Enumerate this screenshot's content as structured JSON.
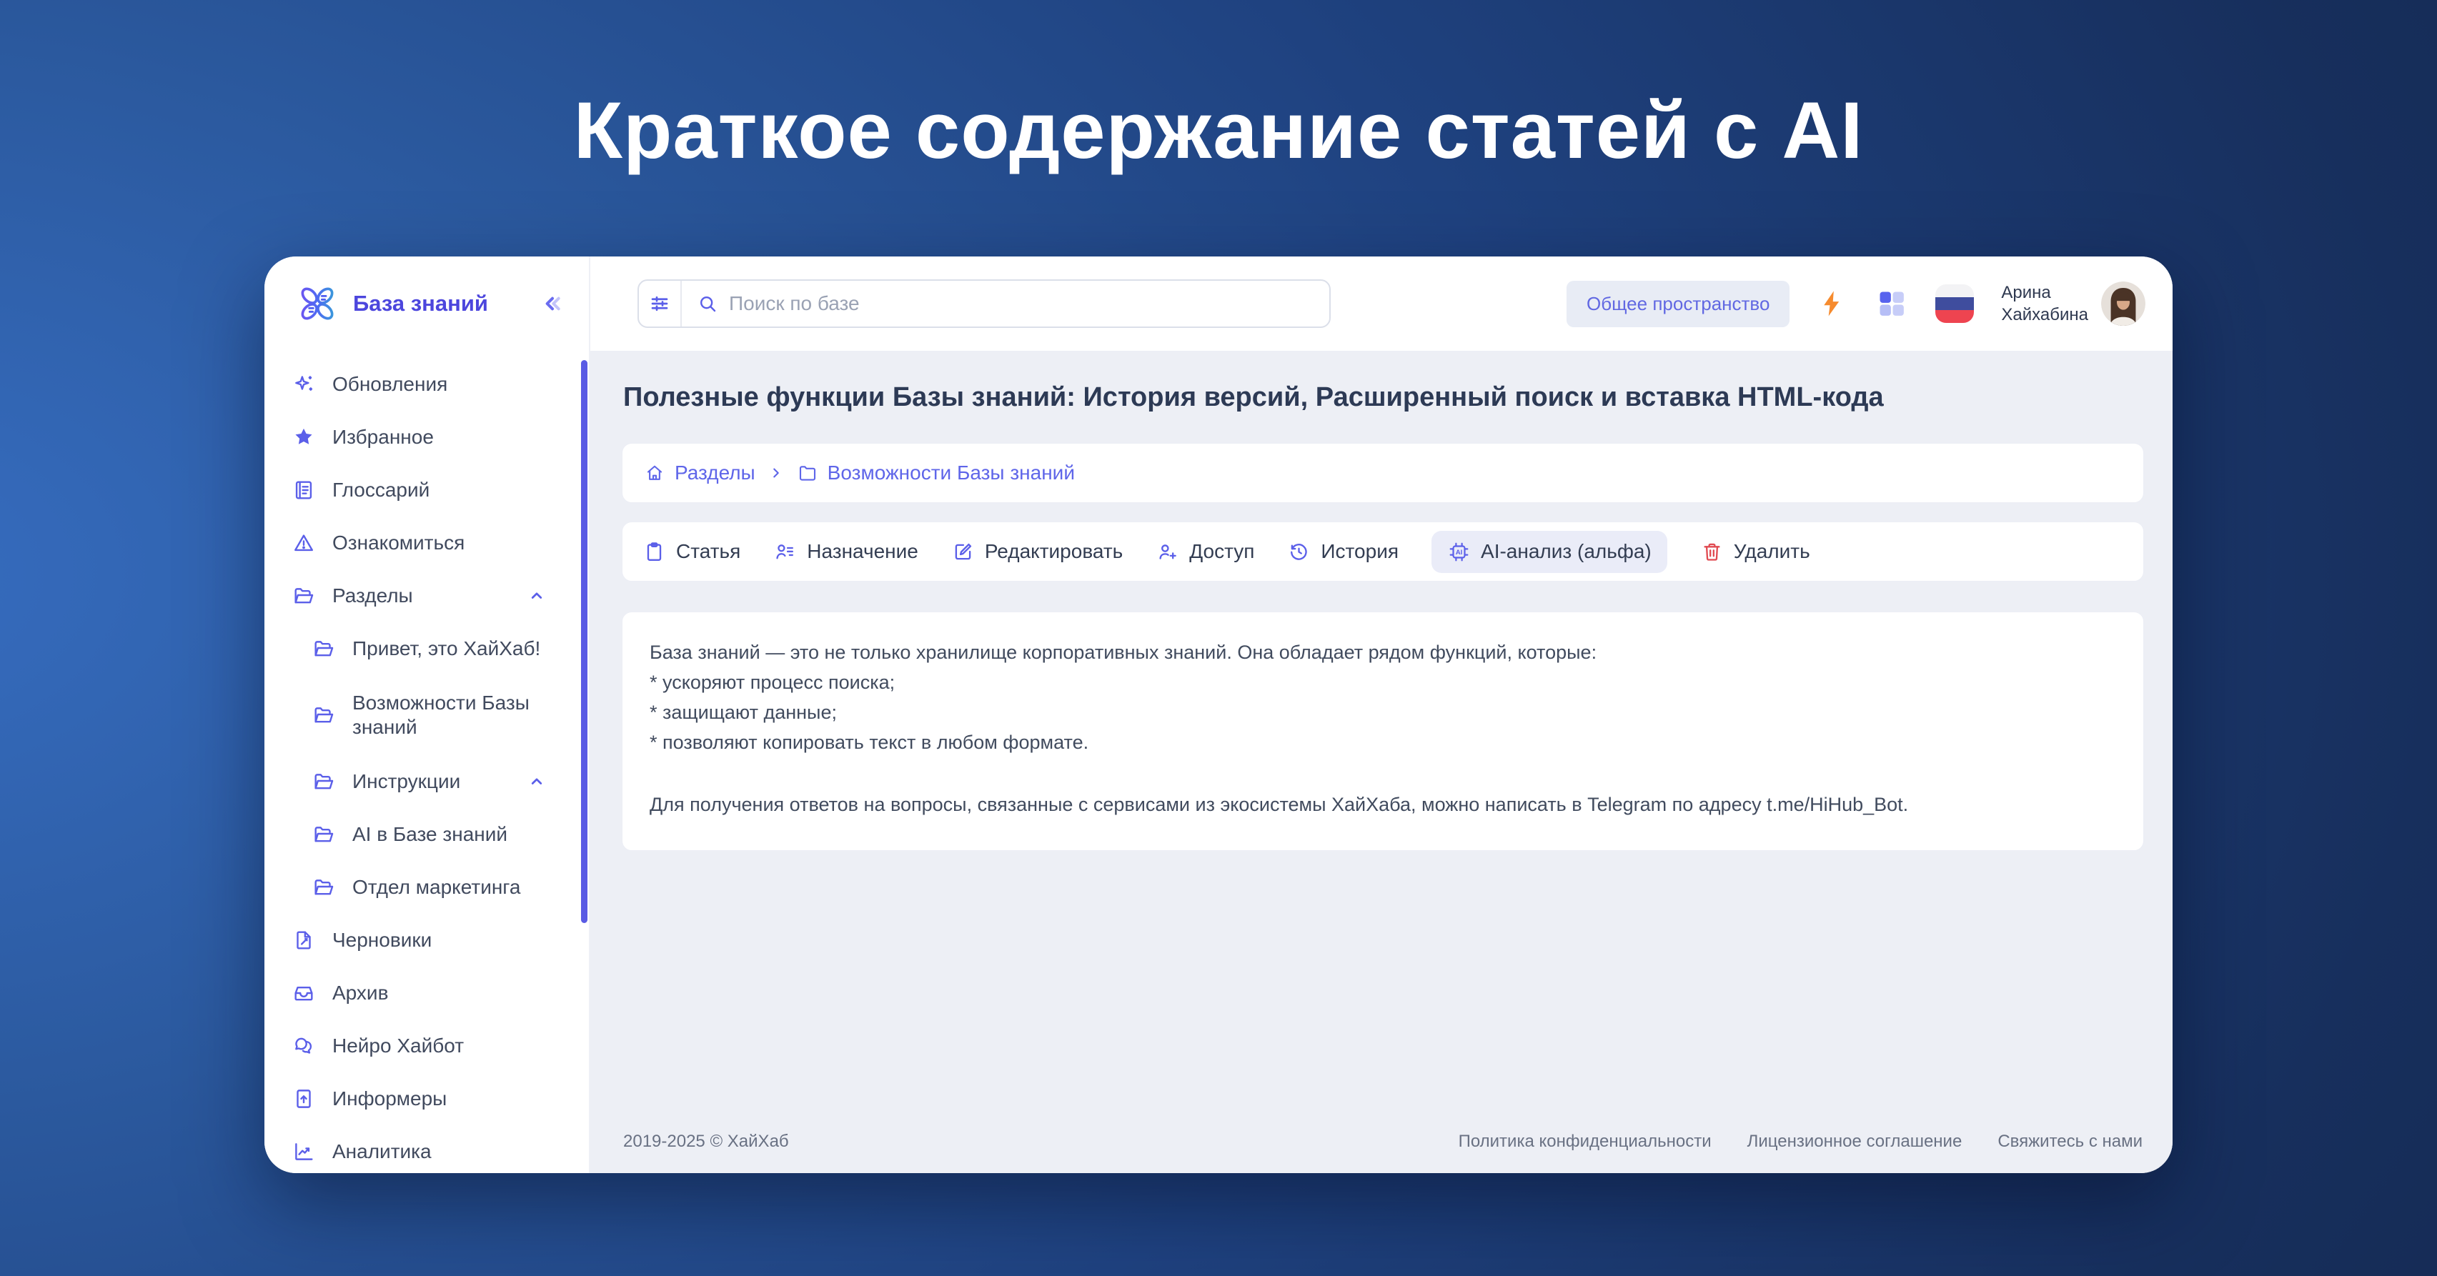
{
  "hero": {
    "title": "Краткое содержание статей с AI"
  },
  "app": {
    "name": "База знаний",
    "collapse_icon": "double-chevron-left-icon"
  },
  "sidebar": {
    "items": [
      {
        "label": "Обновления",
        "icon": "sparkles-icon",
        "level": 0
      },
      {
        "label": "Избранное",
        "icon": "star-icon",
        "level": 0
      },
      {
        "label": "Глоссарий",
        "icon": "book-icon",
        "level": 0
      },
      {
        "label": "Ознакомиться",
        "icon": "warning-icon",
        "level": 0
      },
      {
        "label": "Разделы",
        "icon": "folder-open-icon",
        "level": 0,
        "expanded": true
      },
      {
        "label": "Привет, это ХайХаб!",
        "icon": "folder-open-icon",
        "level": 1
      },
      {
        "label": "Возможности Базы знаний",
        "icon": "folder-open-icon",
        "level": 1
      },
      {
        "label": "Инструкции",
        "icon": "folder-open-icon",
        "level": 1,
        "expanded": true
      },
      {
        "label": "AI в Базе знаний",
        "icon": "folder-open-icon",
        "level": 1
      },
      {
        "label": "Отдел маркетинга",
        "icon": "folder-open-icon",
        "level": 1
      },
      {
        "label": "Черновики",
        "icon": "draft-icon",
        "level": 0
      },
      {
        "label": "Архив",
        "icon": "archive-icon",
        "level": 0
      },
      {
        "label": "Нейро Хайбот",
        "icon": "chat-icon",
        "level": 0
      },
      {
        "label": "Информеры",
        "icon": "informer-icon",
        "level": 0
      },
      {
        "label": "Аналитика",
        "icon": "analytics-icon",
        "level": 0
      }
    ]
  },
  "topbar": {
    "search_placeholder": "Поиск по базе",
    "space_badge": "Общее пространство",
    "user": {
      "name_line1": "Арина",
      "name_line2": "Хайхабина"
    }
  },
  "article": {
    "title": "Полезные функции Базы знаний: История версий, Расширенный поиск и вставка HTML-кода",
    "breadcrumb": {
      "root": "Разделы",
      "current": "Возможности Базы знаний"
    },
    "toolbar": {
      "buttons": [
        "Статья",
        "Назначение",
        "Редактировать",
        "Доступ",
        "История",
        "AI-анализ (альфа)",
        "Удалить"
      ]
    },
    "body": [
      "База знаний — это не только хранилище корпоративных знаний. Она обладает рядом функций, которые:",
      "* ускоряют процесс поиска;",
      "* защищают данные;",
      "* позволяют копировать текст в любом формате.",
      "Для получения ответов на вопросы, связанные с сервисами из экосистемы ХайХаба, можно написать в Telegram по адресу t.me/HiHub_Bot."
    ]
  },
  "footer": {
    "copyright": "2019-2025 © ХайХаб",
    "links": [
      "Политика конфиденциальности",
      "Лицензионное соглашение",
      "Свяжитесь с нами"
    ]
  },
  "colors": {
    "accent": "#5b5fe9",
    "danger": "#e14b52",
    "bolt_orange": "#f68b2e",
    "badge_bg": "#e8ecf5",
    "content_bg": "#edeff5",
    "slide_navy": "#112343"
  }
}
